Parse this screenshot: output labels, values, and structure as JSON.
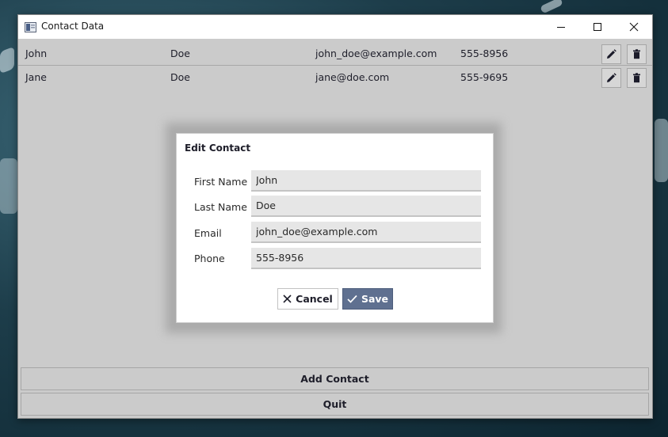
{
  "window": {
    "title": "Contact Data"
  },
  "contacts": [
    {
      "first": "John",
      "last": "Doe",
      "email": "john_doe@example.com",
      "phone": "555-8956"
    },
    {
      "first": "Jane",
      "last": "Doe",
      "email": "jane@doe.com",
      "phone": "555-9695"
    }
  ],
  "dialog": {
    "title": "Edit Contact",
    "fields": [
      {
        "label": "First Name",
        "value": "John"
      },
      {
        "label": "Last Name",
        "value": "Doe"
      },
      {
        "label": "Email",
        "value": "john_doe@example.com"
      },
      {
        "label": "Phone",
        "value": "555-8956"
      }
    ],
    "cancel_label": "Cancel",
    "save_label": "Save"
  },
  "footer": {
    "add_label": "Add Contact",
    "quit_label": "Quit"
  },
  "colors": {
    "accent": "#5f7090",
    "window_bg": "#cbcbcb",
    "input_bg": "#e6e6e6"
  },
  "icons": [
    "app-icon",
    "minimize-icon",
    "maximize-icon",
    "close-icon",
    "pencil-icon",
    "trash-icon",
    "x-icon",
    "check-icon"
  ]
}
